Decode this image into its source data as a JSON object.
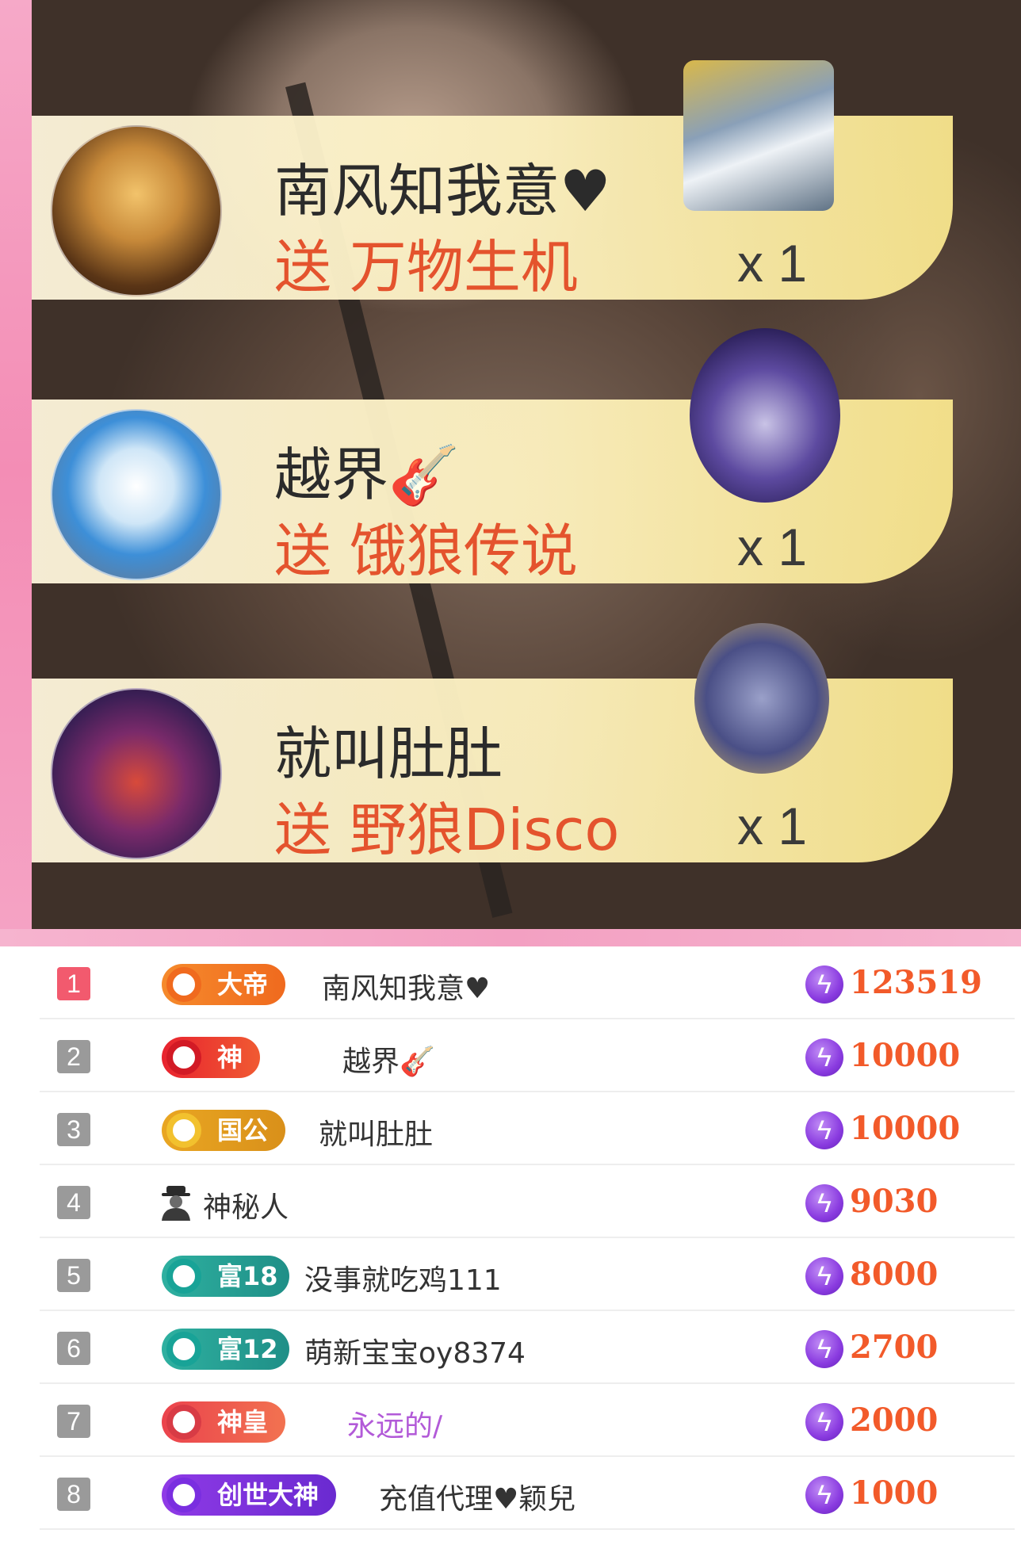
{
  "gift_feed": [
    {
      "user": "南风知我意♥",
      "desc": "送 万物生机",
      "count": "x 1"
    },
    {
      "user": "越界🎸",
      "desc": "送 饿狼传说",
      "count": "x 1"
    },
    {
      "user": "就叫肚肚",
      "desc": "送 野狼Disco",
      "count": "x 1"
    }
  ],
  "ranking": [
    {
      "rank": "1",
      "badge": "大帝",
      "name": "南风知我意♥",
      "score": "123519"
    },
    {
      "rank": "2",
      "badge": "神",
      "name": "越界🎸",
      "score": "10000"
    },
    {
      "rank": "3",
      "badge": "国公",
      "name": "就叫肚肚",
      "score": "10000"
    },
    {
      "rank": "4",
      "badge": "",
      "name": "神秘人",
      "score": "9030"
    },
    {
      "rank": "5",
      "badge": "富18",
      "name": "没事就吃鸡111",
      "score": "8000"
    },
    {
      "rank": "6",
      "badge": "富12",
      "name": "萌新宝宝oy8374",
      "score": "2700"
    },
    {
      "rank": "7",
      "badge": "神皇",
      "name": "永远的/",
      "score": "2000"
    },
    {
      "rank": "8",
      "badge": "创世大神",
      "name": "充值代理♥颖兒",
      "score": "1000"
    }
  ],
  "colors": {
    "rank_top": "#f25a6e",
    "score": "#f25a2a",
    "gift_text": "#e4532d",
    "bolt": "#8a3be0"
  },
  "icons": {
    "score_icon": "lightning-bolt-icon",
    "anon_icon": "mystery-person-icon"
  }
}
